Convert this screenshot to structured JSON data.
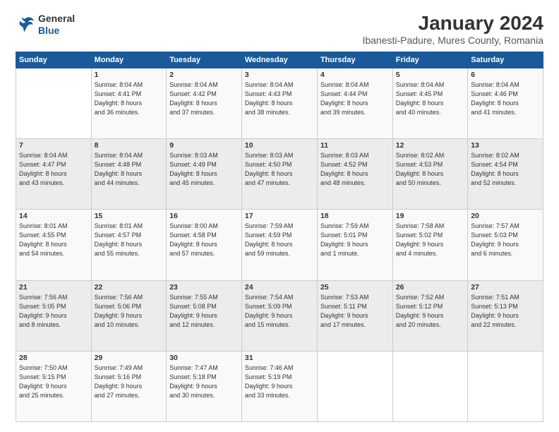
{
  "logo": {
    "line1": "General",
    "line2": "Blue"
  },
  "title": "January 2024",
  "subtitle": "Ibanesti-Padure, Mures County, Romania",
  "header_days": [
    "Sunday",
    "Monday",
    "Tuesday",
    "Wednesday",
    "Thursday",
    "Friday",
    "Saturday"
  ],
  "weeks": [
    [
      {
        "num": "",
        "info": ""
      },
      {
        "num": "1",
        "info": "Sunrise: 8:04 AM\nSunset: 4:41 PM\nDaylight: 8 hours\nand 36 minutes."
      },
      {
        "num": "2",
        "info": "Sunrise: 8:04 AM\nSunset: 4:42 PM\nDaylight: 8 hours\nand 37 minutes."
      },
      {
        "num": "3",
        "info": "Sunrise: 8:04 AM\nSunset: 4:43 PM\nDaylight: 8 hours\nand 38 minutes."
      },
      {
        "num": "4",
        "info": "Sunrise: 8:04 AM\nSunset: 4:44 PM\nDaylight: 8 hours\nand 39 minutes."
      },
      {
        "num": "5",
        "info": "Sunrise: 8:04 AM\nSunset: 4:45 PM\nDaylight: 8 hours\nand 40 minutes."
      },
      {
        "num": "6",
        "info": "Sunrise: 8:04 AM\nSunset: 4:46 PM\nDaylight: 8 hours\nand 41 minutes."
      }
    ],
    [
      {
        "num": "7",
        "info": "Sunrise: 8:04 AM\nSunset: 4:47 PM\nDaylight: 8 hours\nand 43 minutes."
      },
      {
        "num": "8",
        "info": "Sunrise: 8:04 AM\nSunset: 4:48 PM\nDaylight: 8 hours\nand 44 minutes."
      },
      {
        "num": "9",
        "info": "Sunrise: 8:03 AM\nSunset: 4:49 PM\nDaylight: 8 hours\nand 45 minutes."
      },
      {
        "num": "10",
        "info": "Sunrise: 8:03 AM\nSunset: 4:50 PM\nDaylight: 8 hours\nand 47 minutes."
      },
      {
        "num": "11",
        "info": "Sunrise: 8:03 AM\nSunset: 4:52 PM\nDaylight: 8 hours\nand 48 minutes."
      },
      {
        "num": "12",
        "info": "Sunrise: 8:02 AM\nSunset: 4:53 PM\nDaylight: 8 hours\nand 50 minutes."
      },
      {
        "num": "13",
        "info": "Sunrise: 8:02 AM\nSunset: 4:54 PM\nDaylight: 8 hours\nand 52 minutes."
      }
    ],
    [
      {
        "num": "14",
        "info": "Sunrise: 8:01 AM\nSunset: 4:55 PM\nDaylight: 8 hours\nand 54 minutes."
      },
      {
        "num": "15",
        "info": "Sunrise: 8:01 AM\nSunset: 4:57 PM\nDaylight: 8 hours\nand 55 minutes."
      },
      {
        "num": "16",
        "info": "Sunrise: 8:00 AM\nSunset: 4:58 PM\nDaylight: 8 hours\nand 57 minutes."
      },
      {
        "num": "17",
        "info": "Sunrise: 7:59 AM\nSunset: 4:59 PM\nDaylight: 8 hours\nand 59 minutes."
      },
      {
        "num": "18",
        "info": "Sunrise: 7:59 AM\nSunset: 5:01 PM\nDaylight: 9 hours\nand 1 minute."
      },
      {
        "num": "19",
        "info": "Sunrise: 7:58 AM\nSunset: 5:02 PM\nDaylight: 9 hours\nand 4 minutes."
      },
      {
        "num": "20",
        "info": "Sunrise: 7:57 AM\nSunset: 5:03 PM\nDaylight: 9 hours\nand 6 minutes."
      }
    ],
    [
      {
        "num": "21",
        "info": "Sunrise: 7:56 AM\nSunset: 5:05 PM\nDaylight: 9 hours\nand 8 minutes."
      },
      {
        "num": "22",
        "info": "Sunrise: 7:56 AM\nSunset: 5:06 PM\nDaylight: 9 hours\nand 10 minutes."
      },
      {
        "num": "23",
        "info": "Sunrise: 7:55 AM\nSunset: 5:08 PM\nDaylight: 9 hours\nand 12 minutes."
      },
      {
        "num": "24",
        "info": "Sunrise: 7:54 AM\nSunset: 5:09 PM\nDaylight: 9 hours\nand 15 minutes."
      },
      {
        "num": "25",
        "info": "Sunrise: 7:53 AM\nSunset: 5:11 PM\nDaylight: 9 hours\nand 17 minutes."
      },
      {
        "num": "26",
        "info": "Sunrise: 7:52 AM\nSunset: 5:12 PM\nDaylight: 9 hours\nand 20 minutes."
      },
      {
        "num": "27",
        "info": "Sunrise: 7:51 AM\nSunset: 5:13 PM\nDaylight: 9 hours\nand 22 minutes."
      }
    ],
    [
      {
        "num": "28",
        "info": "Sunrise: 7:50 AM\nSunset: 5:15 PM\nDaylight: 9 hours\nand 25 minutes."
      },
      {
        "num": "29",
        "info": "Sunrise: 7:49 AM\nSunset: 5:16 PM\nDaylight: 9 hours\nand 27 minutes."
      },
      {
        "num": "30",
        "info": "Sunrise: 7:47 AM\nSunset: 5:18 PM\nDaylight: 9 hours\nand 30 minutes."
      },
      {
        "num": "31",
        "info": "Sunrise: 7:46 AM\nSunset: 5:19 PM\nDaylight: 9 hours\nand 33 minutes."
      },
      {
        "num": "",
        "info": ""
      },
      {
        "num": "",
        "info": ""
      },
      {
        "num": "",
        "info": ""
      }
    ]
  ]
}
